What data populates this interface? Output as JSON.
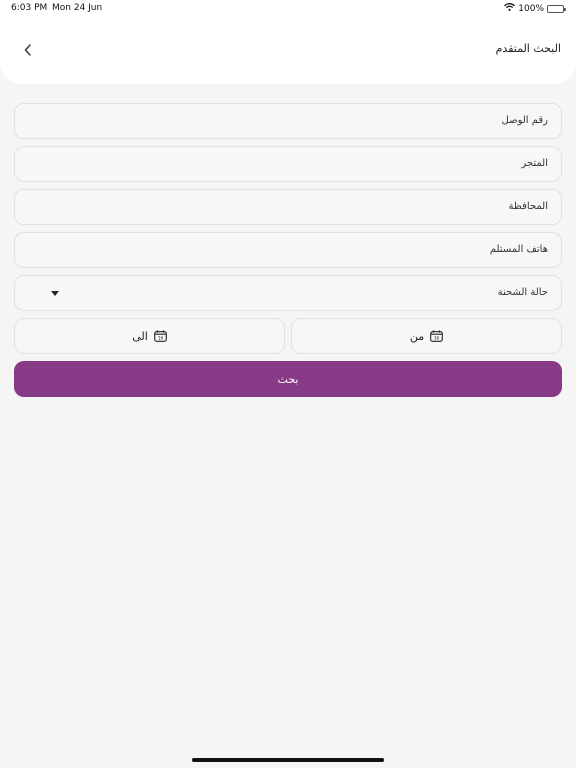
{
  "status_bar": {
    "time": "6:03 PM",
    "date": "Mon 24 Jun",
    "battery": "100%"
  },
  "header": {
    "title": "البحث المتقدم",
    "back_icon": "chevron-left-icon"
  },
  "form": {
    "receipt_number": "رقم الوصل",
    "store": "المتجر",
    "governorate": "المحافظة",
    "recipient_phone": "هاتف المستلم",
    "shipment_status": "حالة الشحنة",
    "date_from": "من",
    "date_to": "الى",
    "search_button": "بحث"
  },
  "colors": {
    "accent": "#873a85",
    "background": "#f5f5f6"
  }
}
